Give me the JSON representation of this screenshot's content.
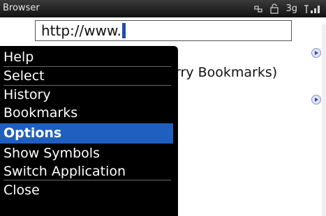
{
  "statusbar": {
    "title": "Browser",
    "network": "3g"
  },
  "browser": {
    "url_value": "http://www.",
    "bookmark_text": "rry Bookmarks)"
  },
  "menu": {
    "items": [
      {
        "label": "Help"
      },
      {
        "label": "Select"
      },
      {
        "label": "History"
      },
      {
        "label": "Bookmarks"
      },
      {
        "label": "Options"
      },
      {
        "label": "Show Symbols"
      },
      {
        "label": "Switch Application"
      },
      {
        "label": "Close"
      }
    ],
    "selected_index": 4,
    "selected_color": "#1f5fbf"
  },
  "icons": {
    "status": [
      "connection-icon",
      "lock-icon",
      "signal-icon"
    ],
    "expand": "expand-icon"
  }
}
